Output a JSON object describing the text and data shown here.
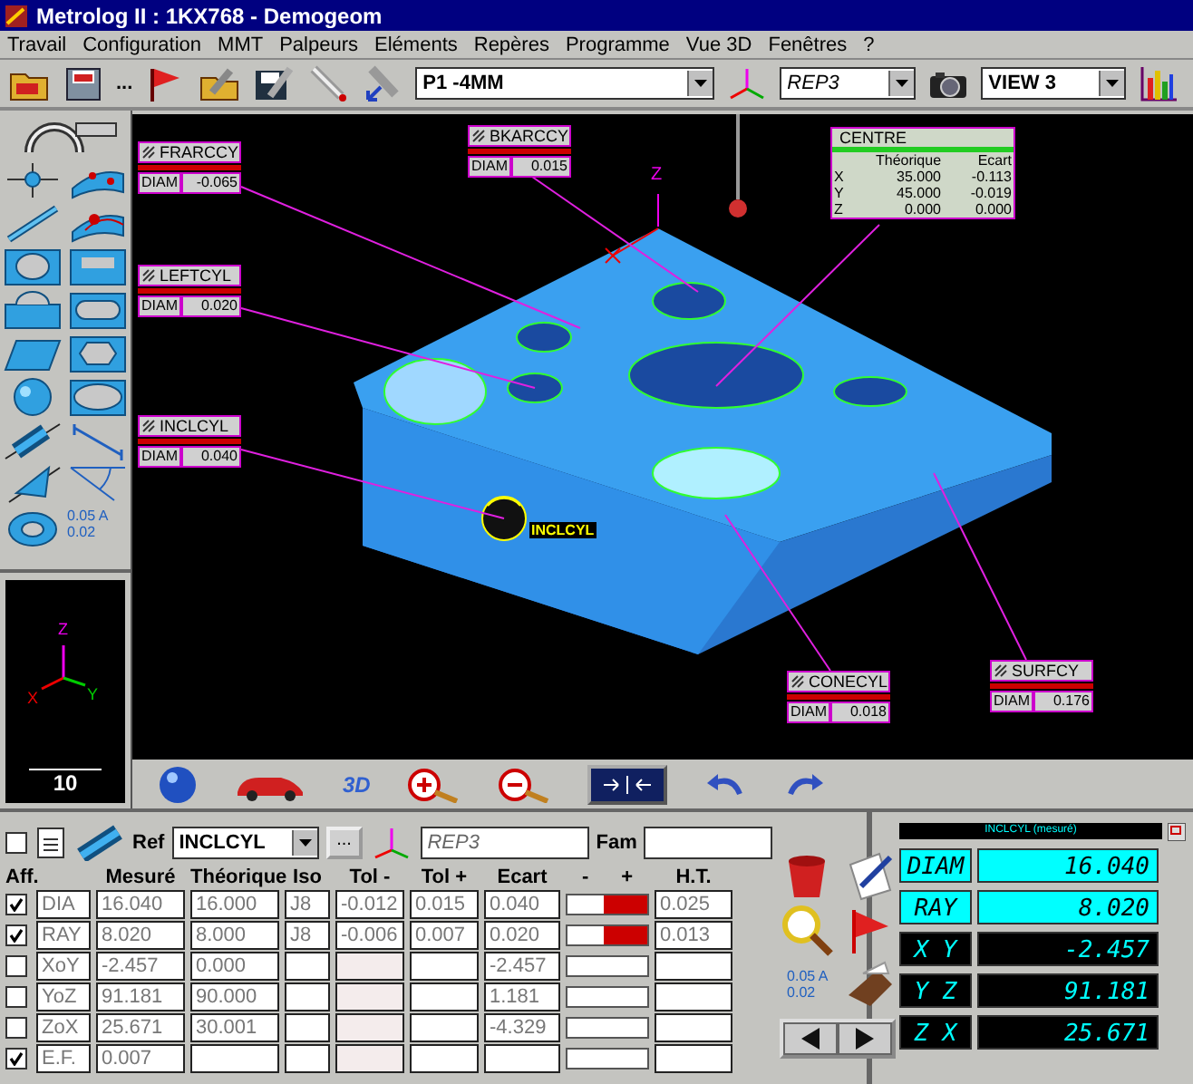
{
  "window": {
    "title": "Metrolog II : 1KX768 - Demogeom"
  },
  "menu": [
    "Travail",
    "Configuration",
    "MMT",
    "Palpeurs",
    "Eléments",
    "Repères",
    "Programme",
    "Vue 3D",
    "Fenêtres",
    "?"
  ],
  "toolbar": {
    "more": "...",
    "probe": "P1 -4MM",
    "frame": "REP3",
    "view": "VIEW 3"
  },
  "palette": {
    "tolerance_text": [
      "0.05 A",
      "0.02"
    ]
  },
  "axis_view": {
    "axes": [
      "Z",
      "X",
      "Y"
    ],
    "scale": "10"
  },
  "viewport": {
    "axis_label": "Z",
    "probe_label": "INCLCYL",
    "callouts": [
      {
        "name": "FRARCCY",
        "param": "DIAM",
        "value": "-0.065"
      },
      {
        "name": "BKARCCY",
        "param": "DIAM",
        "value": "0.015"
      },
      {
        "name": "LEFTCYL",
        "param": "DIAM",
        "value": "0.020"
      },
      {
        "name": "INCLCYL",
        "param": "DIAM",
        "value": "0.040"
      },
      {
        "name": "CONECYL",
        "param": "DIAM",
        "value": "0.018"
      },
      {
        "name": "SURFCY",
        "param": "DIAM",
        "value": "0.176"
      }
    ],
    "centre": {
      "title": "CENTRE",
      "columns": [
        "Théorique",
        "Ecart"
      ],
      "rows": [
        {
          "axis": "X",
          "nominal": "35.000",
          "deviation": "-0.113"
        },
        {
          "axis": "Y",
          "nominal": "45.000",
          "deviation": "-0.019"
        },
        {
          "axis": "Z",
          "nominal": "0.000",
          "deviation": "0.000"
        }
      ]
    }
  },
  "view_toolbar": {
    "mode_3d": "3D"
  },
  "element_panel": {
    "show_all": false,
    "ref_label": "Ref",
    "ref": "INCLCYL",
    "more": "...",
    "frame": "REP3",
    "fam_label": "Fam",
    "columns": [
      "Aff.",
      "Mesuré",
      "Théorique",
      "Iso",
      "Tol -",
      "Tol +",
      "Ecart",
      "-",
      "+",
      "H.T."
    ],
    "rows": [
      {
        "aff": true,
        "name": "DIA",
        "measured": "16.040",
        "nominal": "16.000",
        "iso": "J8",
        "tol_minus": "-0.012",
        "tol_plus": "0.015",
        "deviation": "0.040",
        "out_of_tolerance": true,
        "ht": "0.025"
      },
      {
        "aff": true,
        "name": "RAY",
        "measured": "8.020",
        "nominal": "8.000",
        "iso": "J8",
        "tol_minus": "-0.006",
        "tol_plus": "0.007",
        "deviation": "0.020",
        "out_of_tolerance": true,
        "ht": "0.013"
      },
      {
        "aff": false,
        "name": "XoY",
        "measured": "-2.457",
        "nominal": "0.000",
        "deviation": "-2.457",
        "out_of_tolerance": false
      },
      {
        "aff": false,
        "name": "YoZ",
        "measured": "91.181",
        "nominal": "90.000",
        "deviation": "1.181",
        "out_of_tolerance": false
      },
      {
        "aff": false,
        "name": "ZoX",
        "measured": "25.671",
        "nominal": "30.001",
        "deviation": "-4.329",
        "out_of_tolerance": false
      },
      {
        "aff": true,
        "name": "E.F.",
        "measured": "0.007",
        "out_of_tolerance": false
      }
    ],
    "tolerance_text": [
      "0.05 A",
      "0.02"
    ]
  },
  "readout": {
    "title": "INCLCYL (mesuré)",
    "rows": [
      {
        "label": "DIAM",
        "value": "16.040",
        "selected": true
      },
      {
        "label": "RAY",
        "value": "8.020",
        "selected": true
      },
      {
        "label": "X Y",
        "value": "-2.457",
        "selected": false
      },
      {
        "label": "Y Z",
        "value": "91.181",
        "selected": false
      },
      {
        "label": "Z X",
        "value": "25.671",
        "selected": false
      }
    ]
  }
}
